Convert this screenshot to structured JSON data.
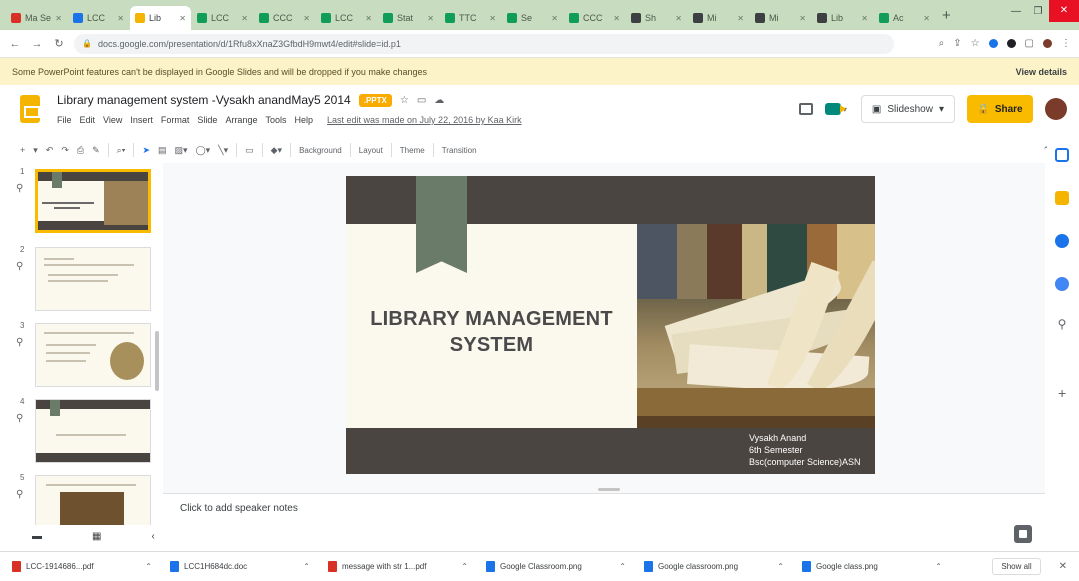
{
  "browser": {
    "tabs": [
      {
        "label": "Ma Sem",
        "color": "#d93025",
        "active": false
      },
      {
        "label": "LCC",
        "color": "#1a73e8",
        "active": false
      },
      {
        "label": "Lib",
        "color": "#f4b400",
        "active": true
      },
      {
        "label": "LCC",
        "color": "#0f9d58",
        "active": false
      },
      {
        "label": "CCC",
        "color": "#0f9d58",
        "active": false
      },
      {
        "label": "LCC",
        "color": "#0f9d58",
        "active": false
      },
      {
        "label": "Stat",
        "color": "#0f9d58",
        "active": false
      },
      {
        "label": "TTC",
        "color": "#0f9d58",
        "active": false
      },
      {
        "label": "Se",
        "color": "#0f9d58",
        "active": false
      },
      {
        "label": "CCC",
        "color": "#0f9d58",
        "active": false
      },
      {
        "label": "Sh",
        "color": "#3c4043",
        "active": false
      },
      {
        "label": "Mi",
        "color": "#3c4043",
        "active": false
      },
      {
        "label": "Mi",
        "color": "#3c4043",
        "active": false
      },
      {
        "label": "Lib",
        "color": "#3c4043",
        "active": false
      },
      {
        "label": "Ac",
        "color": "#0f9d58",
        "active": false
      }
    ],
    "new_tab_label": "+",
    "url": "docs.google.com/presentation/d/1Rfu8xXnaZ3GfbdH9mwt4/edit#slide=id.p1",
    "lock_icon": "🔒"
  },
  "banner": {
    "message": "Some PowerPoint features can't be displayed in Google Slides and will be dropped if you make changes",
    "details_label": "View details"
  },
  "doc": {
    "title": "Library management system -Vysakh anandMay5 2014",
    "badge": ".PPTX",
    "menu": [
      "File",
      "Edit",
      "View",
      "Insert",
      "Format",
      "Slide",
      "Arrange",
      "Tools",
      "Help"
    ],
    "last_edit": "Last edit was made on July 22, 2016 by Kaa Kirk",
    "slideshow_label": "Slideshow",
    "share_label": "Share"
  },
  "toolbar": {
    "background_label": "Background",
    "layout_label": "Layout",
    "theme_label": "Theme",
    "transition_label": "Transition"
  },
  "filmstrip": {
    "slides": [
      {
        "number": "1",
        "selected": true
      },
      {
        "number": "2",
        "selected": false
      },
      {
        "number": "3",
        "selected": false
      },
      {
        "number": "4",
        "selected": false
      },
      {
        "number": "5",
        "selected": false
      }
    ]
  },
  "slide": {
    "title_line1": "LIBRARY MANAGEMENT",
    "title_line2": "SYSTEM",
    "author_line1": "Vysakh Anand",
    "author_line2": "6th Semester",
    "author_line3": "Bsc(computer Science)ASN"
  },
  "notes": {
    "placeholder": "Click to add speaker notes"
  },
  "downloads": {
    "items": [
      {
        "name": "LCC-1914686...pdf",
        "color": "#d93025"
      },
      {
        "name": "LCC1H684dc.doc",
        "color": "#1a73e8"
      },
      {
        "name": "message with str 1...pdf",
        "color": "#d93025"
      },
      {
        "name": "Google Classroom.png",
        "color": "#1a73e8"
      },
      {
        "name": "Google classroom.png",
        "color": "#1a73e8"
      },
      {
        "name": "Google class.png",
        "color": "#1a73e8"
      }
    ],
    "show_all_label": "Show all"
  },
  "colors": {
    "accent": "#f9bb00",
    "slide_band": "#4b4541",
    "ribbon": "#6b7b6a",
    "banner": "#fdf3c8"
  }
}
